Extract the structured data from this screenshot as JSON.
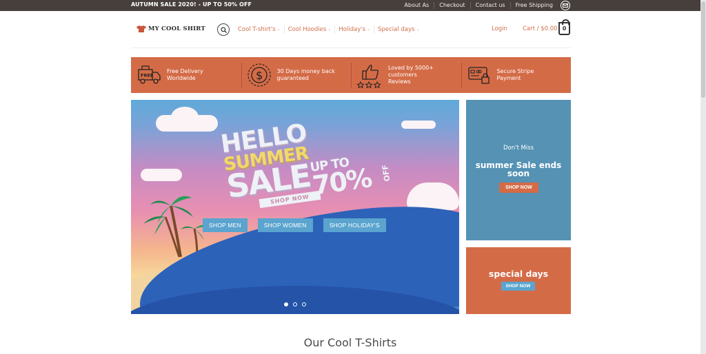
{
  "topbar": {
    "promo": "AUTUMN SALE 2020! - UP TO 50% OFF",
    "links": [
      "About As",
      "Checkout",
      "Contact us",
      "Free Shipping"
    ]
  },
  "header": {
    "logo_text": "MY COOL SHIRT",
    "nav": [
      {
        "label": "Cool T-shirt's"
      },
      {
        "label": "Cool Hoodies"
      },
      {
        "label": "Holiday's"
      },
      {
        "label": "Special days"
      }
    ],
    "login": "Login",
    "cart_label": "Cart / $0.00",
    "cart_count": "0"
  },
  "features": [
    {
      "icon": "free-delivery-truck-icon",
      "line1": "Free Delivery",
      "line2": "Worldwide",
      "badge": "FREE"
    },
    {
      "icon": "dollar-coin-icon",
      "line1": "30 Days money back",
      "line2": "guaranteed"
    },
    {
      "icon": "thumbs-up-stars-icon",
      "line1": "Loved by 5000+ customers",
      "line2": "Reviews"
    },
    {
      "icon": "credit-card-lock-icon",
      "line1": "Secure Stripe",
      "line2": "Payment"
    }
  ],
  "hero": {
    "line1": "HELLO",
    "line2": "SUMMER",
    "line3": "SALE",
    "up_to": "UP TO",
    "percent": "70%",
    "off": "OFF",
    "tag": "SHOP NOW",
    "buttons": [
      "SHOP MEN",
      "SHOP WOMEN",
      "SHOP HOLIDAY'S"
    ],
    "slides": 3,
    "active_slide": 1
  },
  "side_banner_1": {
    "pre": "Don't Miss",
    "title_line1": "summer Sale ends",
    "title_line2": "soon",
    "button": "SHOP NOW"
  },
  "side_banner_2": {
    "title": "special days",
    "button": "SHOP NOW"
  },
  "section": {
    "title": "Our Cool T-Shirts"
  },
  "colors": {
    "accent": "#d46b47",
    "topbar": "#473f3c",
    "blue": "#5592b4"
  }
}
